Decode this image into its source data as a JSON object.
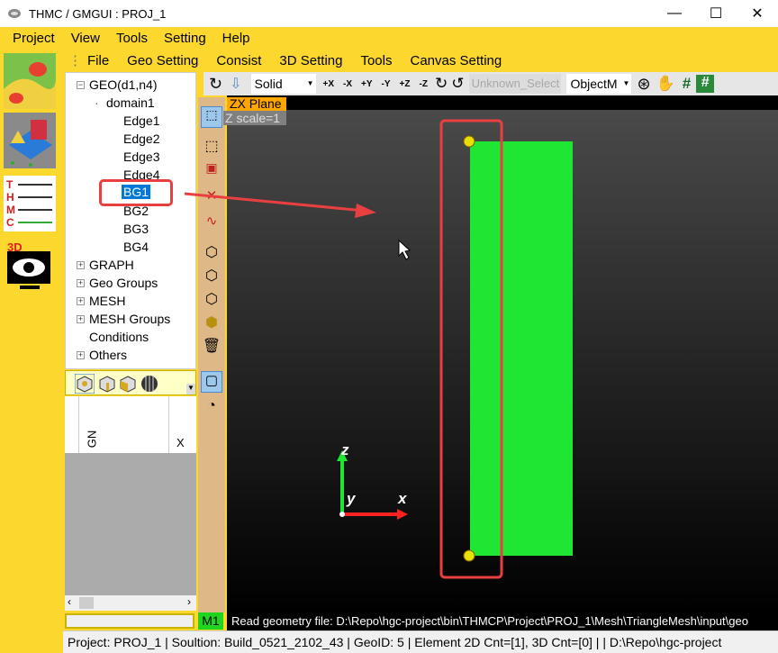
{
  "window": {
    "title": "THMC / GMGUI : PROJ_1",
    "minimize": "—",
    "maximize": "☐",
    "close": "✕"
  },
  "menu": [
    "Project",
    "View",
    "Tools",
    "Setting",
    "Help"
  ],
  "toolbar2": [
    "File",
    "Geo Setting",
    "Consist",
    "3D Setting",
    "Tools",
    "Canvas Setting"
  ],
  "toolbar3": {
    "render_mode": "Solid",
    "axis_buttons": [
      "+X",
      "-X",
      "+Y",
      "-Y",
      "+Z",
      "-Z"
    ],
    "select_mode": "Unknown_Select",
    "object_mode": "ObjectM"
  },
  "tree": {
    "root": "GEO(d1,n4)",
    "domain": "domain1",
    "items": [
      "Edge1",
      "Edge2",
      "Edge3",
      "Edge4",
      "BG1",
      "BG2",
      "BG3",
      "BG4"
    ],
    "selected": "BG1",
    "groups": [
      "GRAPH",
      "Geo Groups",
      "MESH",
      "MESH Groups",
      "Conditions",
      "Others"
    ]
  },
  "table": {
    "columns": [
      "GN",
      "X"
    ]
  },
  "canvas": {
    "plane_label": "ZX Plane",
    "z_scale": "Z scale=1",
    "axes": {
      "z": "z",
      "y": "y",
      "x": "x"
    },
    "shape_color": "#1ee632",
    "highlight_color": "#e84040"
  },
  "m1_label": "M1",
  "message": "Read geometry file: D:\\Repo\\hgc-project\\bin\\THMCP\\Project\\PROJ_1\\Mesh\\TriangleMesh\\input\\geo",
  "status": "Project:  PROJ_1  |  Soultion:  Build_0521_2102_43  |  GeoID:  5  |  Element 2D Cnt=[1], 3D Cnt=[0]  |  |  D:\\Repo\\hgc-project"
}
